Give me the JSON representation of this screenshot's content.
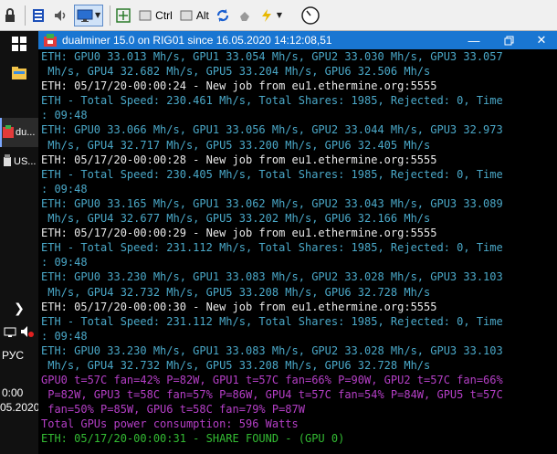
{
  "toolbar": {
    "ctrl_label": "Ctrl",
    "alt_label": "Alt"
  },
  "taskbar": {
    "app1_label": "du...",
    "app2_label": "US...",
    "lang_label": "РУС",
    "time_label": "0:00",
    "date_label": "05.2020"
  },
  "window": {
    "title": "dualminer 15.0 on RIG01 since 16.05.2020 14:12:08,51"
  },
  "colors": {
    "hash": "#4aa8c8",
    "newjob": "#e8e8e8",
    "total": "#4aa8c8",
    "gpu_stats": "#b53fc7",
    "power": "#b53fc7",
    "share": "#33bb33"
  },
  "console": {
    "lines": [
      {
        "text": "ETH: GPU0 33.013 Mh/s, GPU1 33.054 Mh/s, GPU2 33.030 Mh/s, GPU3 33.057",
        "kind": "hash"
      },
      {
        "text": " Mh/s, GPU4 32.682 Mh/s, GPU5 33.204 Mh/s, GPU6 32.506 Mh/s",
        "kind": "hash"
      },
      {
        "text": "ETH: 05/17/20-00:00:24 - New job from eu1.ethermine.org:5555",
        "kind": "newjob"
      },
      {
        "text": "ETH - Total Speed: 230.461 Mh/s, Total Shares: 1985, Rejected: 0, Time",
        "kind": "total"
      },
      {
        "text": ": 09:48",
        "kind": "total"
      },
      {
        "text": "ETH: GPU0 33.066 Mh/s, GPU1 33.056 Mh/s, GPU2 33.044 Mh/s, GPU3 32.973",
        "kind": "hash"
      },
      {
        "text": " Mh/s, GPU4 32.717 Mh/s, GPU5 33.200 Mh/s, GPU6 32.405 Mh/s",
        "kind": "hash"
      },
      {
        "text": "ETH: 05/17/20-00:00:28 - New job from eu1.ethermine.org:5555",
        "kind": "newjob"
      },
      {
        "text": "ETH - Total Speed: 230.405 Mh/s, Total Shares: 1985, Rejected: 0, Time",
        "kind": "total"
      },
      {
        "text": ": 09:48",
        "kind": "total"
      },
      {
        "text": "ETH: GPU0 33.165 Mh/s, GPU1 33.062 Mh/s, GPU2 33.043 Mh/s, GPU3 33.089",
        "kind": "hash"
      },
      {
        "text": " Mh/s, GPU4 32.677 Mh/s, GPU5 33.202 Mh/s, GPU6 32.166 Mh/s",
        "kind": "hash"
      },
      {
        "text": "ETH: 05/17/20-00:00:29 - New job from eu1.ethermine.org:5555",
        "kind": "newjob"
      },
      {
        "text": "ETH - Total Speed: 231.112 Mh/s, Total Shares: 1985, Rejected: 0, Time",
        "kind": "total"
      },
      {
        "text": ": 09:48",
        "kind": "total"
      },
      {
        "text": "ETH: GPU0 33.230 Mh/s, GPU1 33.083 Mh/s, GPU2 33.028 Mh/s, GPU3 33.103",
        "kind": "hash"
      },
      {
        "text": " Mh/s, GPU4 32.732 Mh/s, GPU5 33.208 Mh/s, GPU6 32.728 Mh/s",
        "kind": "hash"
      },
      {
        "text": "ETH: 05/17/20-00:00:30 - New job from eu1.ethermine.org:5555",
        "kind": "newjob"
      },
      {
        "text": "ETH - Total Speed: 231.112 Mh/s, Total Shares: 1985, Rejected: 0, Time",
        "kind": "total"
      },
      {
        "text": ": 09:48",
        "kind": "total"
      },
      {
        "text": "ETH: GPU0 33.230 Mh/s, GPU1 33.083 Mh/s, GPU2 33.028 Mh/s, GPU3 33.103",
        "kind": "hash"
      },
      {
        "text": " Mh/s, GPU4 32.732 Mh/s, GPU5 33.208 Mh/s, GPU6 32.728 Mh/s",
        "kind": "hash"
      },
      {
        "text": "GPU0 t=57C fan=42% P=82W, GPU1 t=57C fan=66% P=90W, GPU2 t=57C fan=66%",
        "kind": "gpu_stats"
      },
      {
        "text": " P=82W, GPU3 t=58C fan=57% P=86W, GPU4 t=57C fan=54% P=84W, GPU5 t=57C",
        "kind": "gpu_stats"
      },
      {
        "text": " fan=50% P=85W, GPU6 t=58C fan=79% P=87W",
        "kind": "gpu_stats"
      },
      {
        "text": "Total GPUs power consumption: 596 Watts",
        "kind": "power"
      },
      {
        "text": "ETH: 05/17/20-00:00:31 - SHARE FOUND - (GPU 0)",
        "kind": "share"
      }
    ]
  }
}
